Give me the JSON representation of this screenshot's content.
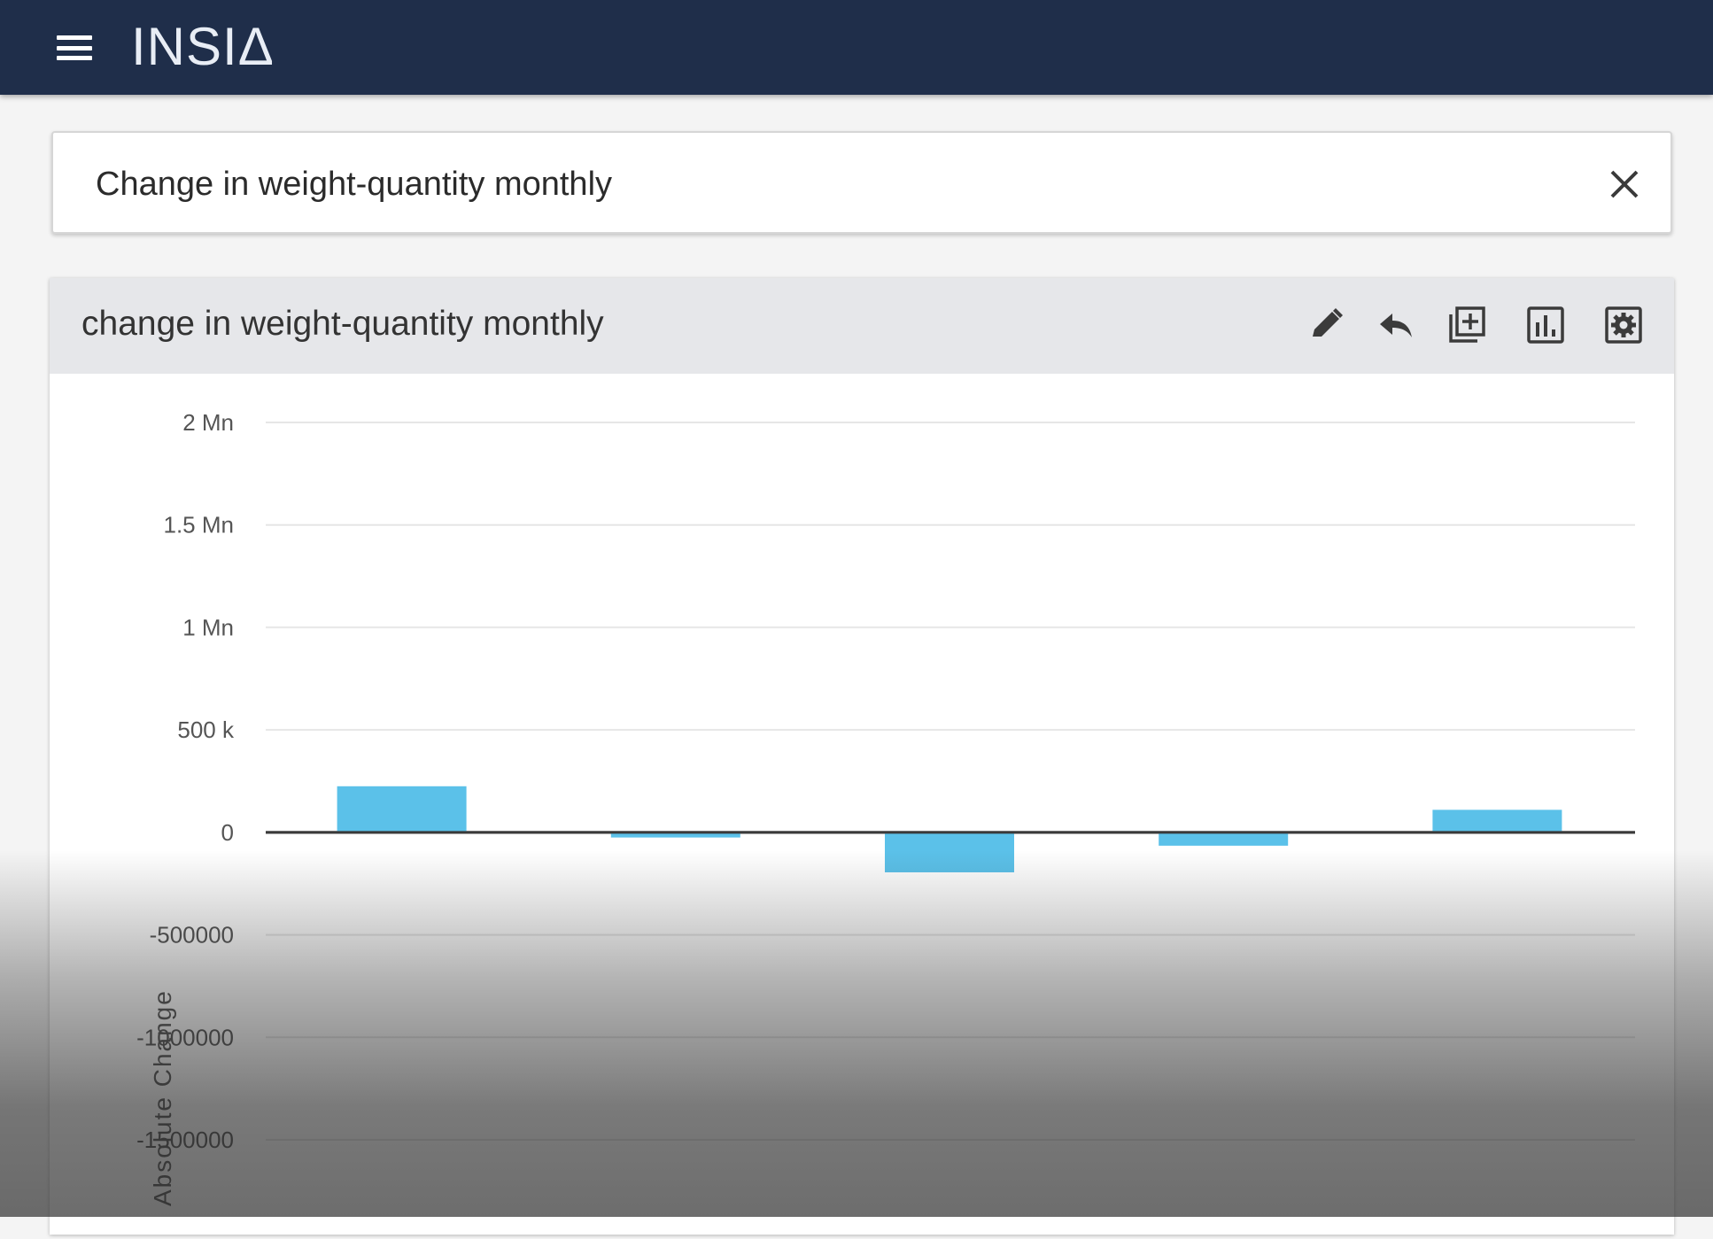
{
  "app": {
    "logo": "INSIΔ"
  },
  "search": {
    "value": "Change in weight-quantity monthly"
  },
  "card": {
    "title": "change in weight-quantity monthly",
    "toolbar": [
      "pencil-icon",
      "undo-icon",
      "add-to-dashboard-icon",
      "chart-type-icon",
      "settings-icon"
    ]
  },
  "colors": {
    "header": "#1f2e4a",
    "bar": "#5bc1e9",
    "card_header": "#e6e7ea"
  },
  "chart_data": {
    "type": "bar",
    "ylabel": "Absolute Change",
    "ylim": [
      -1500000,
      2000000
    ],
    "y_ticks": [
      {
        "value": 2000000,
        "label": "2 Mn"
      },
      {
        "value": 1500000,
        "label": "1.5 Mn"
      },
      {
        "value": 1000000,
        "label": "1 Mn"
      },
      {
        "value": 500000,
        "label": "500 k"
      },
      {
        "value": 0,
        "label": "0"
      },
      {
        "value": -500000,
        "label": "-500000"
      },
      {
        "value": -1000000,
        "label": "-1000000"
      },
      {
        "value": -1500000,
        "label": "-1500000"
      }
    ],
    "values": [
      225000,
      -25000,
      -195000,
      -65000,
      110000
    ],
    "grid": true
  }
}
